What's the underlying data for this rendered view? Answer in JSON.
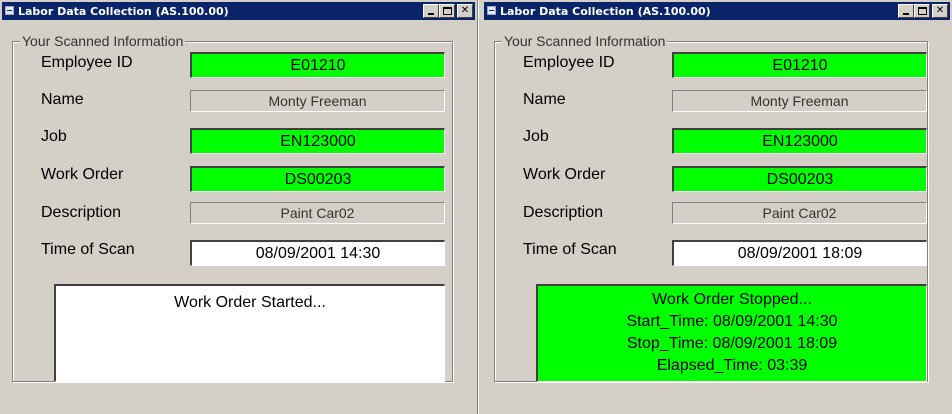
{
  "windows": [
    {
      "title": "Labor Data Collection (AS.100.00)",
      "group_label": "Your Scanned Information",
      "fields": {
        "employee_id": {
          "label": "Employee ID",
          "value": "E01210"
        },
        "name": {
          "label": "Name",
          "value": "Monty Freeman"
        },
        "job": {
          "label": "Job",
          "value": "EN123000"
        },
        "work_order": {
          "label": "Work Order",
          "value": "DS00203"
        },
        "description": {
          "label": "Description",
          "value": "Paint Car02"
        },
        "time_of_scan": {
          "label": "Time of Scan",
          "value": "08/09/2001 14:30"
        }
      },
      "message_lines": [
        "Work Order Started..."
      ]
    },
    {
      "title": "Labor Data Collection (AS.100.00)",
      "group_label": "Your Scanned Information",
      "fields": {
        "employee_id": {
          "label": "Employee ID",
          "value": "E01210"
        },
        "name": {
          "label": "Name",
          "value": "Monty Freeman"
        },
        "job": {
          "label": "Job",
          "value": "EN123000"
        },
        "work_order": {
          "label": "Work Order",
          "value": "DS00203"
        },
        "description": {
          "label": "Description",
          "value": "Paint Car02"
        },
        "time_of_scan": {
          "label": "Time of Scan",
          "value": "08/09/2001 18:09"
        }
      },
      "message_lines": [
        "Work Order Stopped...",
        "Start_Time: 08/09/2001 14:30",
        "Stop_Time: 08/09/2001 18:09",
        "Elapsed_Time: 03:39"
      ]
    }
  ],
  "colors": {
    "scan_ok": "#00ff00",
    "titlebar": "#0a246a",
    "face": "#d4d0c8"
  }
}
